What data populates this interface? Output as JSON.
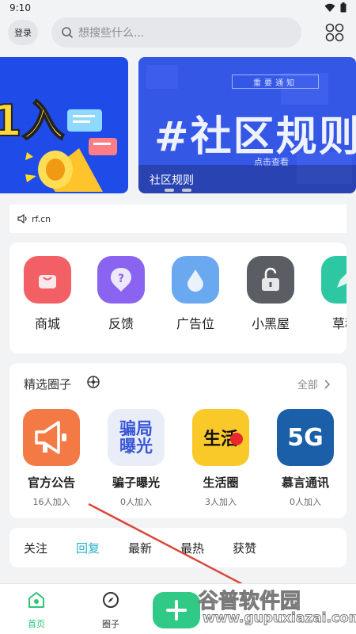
{
  "status": {
    "time": "9:10"
  },
  "top_bar": {
    "login_label": "登录",
    "search_placeholder": "想搜些什么..."
  },
  "banners": [
    {
      "big_text": "1入"
    },
    {
      "header": "重要通知",
      "big_text": "#社区规则",
      "click_hint": "点击查看",
      "caption": "社区规则"
    }
  ],
  "notice": {
    "text": "rf.cn"
  },
  "quick_icons": [
    {
      "label": "商城",
      "color": "#f26065",
      "icon": "shopping-bag-icon"
    },
    {
      "label": "反馈",
      "color": "#8a63f0",
      "icon": "question-icon"
    },
    {
      "label": "广告位",
      "color": "#6aa8f0",
      "icon": "drop-icon"
    },
    {
      "label": "小黑屋",
      "color": "#5a5d63",
      "icon": "unlock-icon"
    },
    {
      "label": "草稿",
      "color": "#2ec7a3",
      "icon": "edit-icon"
    }
  ],
  "circles": {
    "title": "精选圈子",
    "all_label": "全部",
    "items": [
      {
        "name": "官方公告",
        "count": "16人加入",
        "logo_text": "",
        "color": "#f47a45"
      },
      {
        "name": "骗子曝光",
        "count": "0人加入",
        "logo_text": "骗局曝光",
        "color": "#e9edf8"
      },
      {
        "name": "生活圈",
        "count": "3人加入",
        "logo_text": "生活",
        "color": "#f9c92a"
      },
      {
        "name": "慕言通讯",
        "count": "0人加入",
        "logo_text": "5G",
        "color": "#1b5fa8"
      }
    ]
  },
  "feed_tabs": [
    {
      "label": "关注",
      "active": false
    },
    {
      "label": "回复",
      "active": true
    },
    {
      "label": "最新",
      "active": false
    },
    {
      "label": "最热",
      "active": false
    },
    {
      "label": "获赞",
      "active": false
    }
  ],
  "bottom_nav": {
    "home_label": "首页",
    "circles_label": "圈子"
  },
  "watermark": {
    "line1": "谷普软件园",
    "line2": "www.gupuxiazai.com"
  },
  "colors": {
    "accent": "#27b1c9",
    "nav_active": "#2cc57a",
    "plus": "#30c986"
  }
}
